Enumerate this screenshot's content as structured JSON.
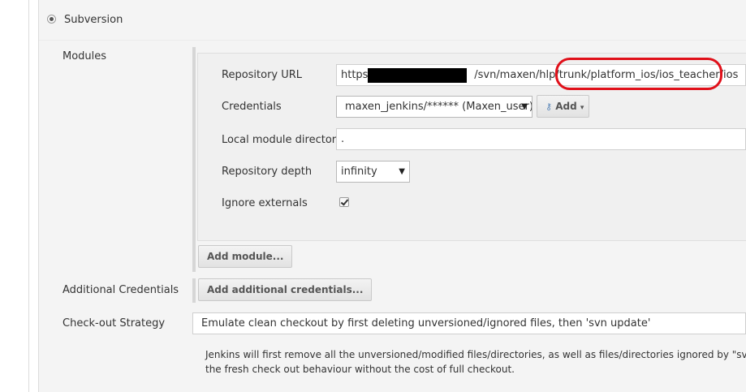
{
  "scm": {
    "option_label": "Subversion"
  },
  "modules": {
    "label": "Modules",
    "repository_url_label": "Repository URL",
    "repository_url_prefix": "https:/",
    "repository_url_suffix": "/svn/maxen/hlp/trunk/platform_ios/ios_teacher/ios",
    "credentials_label": "Credentials",
    "credentials_value": "maxen_jenkins/****** (Maxen_user)",
    "add_button_label": "Add",
    "local_module_dir_label": "Local module directory",
    "local_module_dir_value": ".",
    "repository_depth_label": "Repository depth",
    "repository_depth_value": "infinity",
    "ignore_externals_label": "Ignore externals",
    "ignore_externals_checked": true,
    "add_module_button": "Add module..."
  },
  "additional_credentials": {
    "label": "Additional Credentials",
    "button": "Add additional credentials..."
  },
  "checkout_strategy": {
    "label": "Check-out Strategy",
    "value": "Emulate clean checkout by first deleting unversioned/ignored files, then 'svn update'",
    "help_line1": "Jenkins will first remove all the unversioned/modified files/directories, as well as files/directories ignored by \"svn:igno",
    "help_line2": "the fresh check out behaviour without the cost of full checkout."
  },
  "colors": {
    "annotation": "#e0101a",
    "panel_bg": "#f4f4f4"
  }
}
